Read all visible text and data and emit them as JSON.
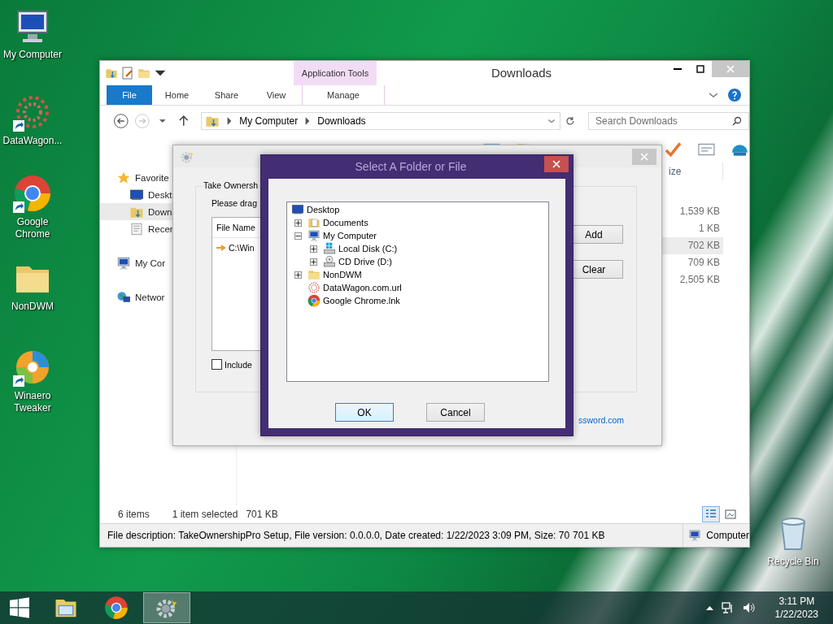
{
  "desktop_icons": [
    {
      "label": "My Computer",
      "kind": "computer",
      "shortcut": false
    },
    {
      "label": "DataWagon...",
      "kind": "flower",
      "shortcut": true
    },
    {
      "label": "Google Chrome",
      "kind": "chrome",
      "shortcut": true
    },
    {
      "label": "NonDWM",
      "kind": "folder",
      "shortcut": false
    },
    {
      "label": "Winaero Tweaker",
      "kind": "swirl",
      "shortcut": true
    },
    {
      "label": "Recycle Bin",
      "kind": "bin",
      "shortcut": false
    }
  ],
  "explorer": {
    "title": "Downloads",
    "contextual_group": "Application Tools",
    "ribbon_tabs": [
      {
        "label": "File",
        "kind": "file"
      },
      {
        "label": "Home",
        "kind": "tab"
      },
      {
        "label": "Share",
        "kind": "tab"
      },
      {
        "label": "View",
        "kind": "tab"
      },
      {
        "label": "Manage",
        "kind": "contextual"
      }
    ],
    "address": {
      "crumbs": [
        "My Computer",
        "Downloads"
      ]
    },
    "search": {
      "placeholder": "Search Downloads"
    },
    "nav": [
      {
        "label": "Favorite",
        "kind": "star",
        "selected": false,
        "children": [
          {
            "label": "Deskt",
            "kind": "desktop",
            "selected": false
          },
          {
            "label": "Down",
            "kind": "downloads",
            "selected": true
          },
          {
            "label": "Recer",
            "kind": "recent",
            "selected": false
          }
        ]
      },
      {
        "label": "My Cor",
        "kind": "computer",
        "selected": false
      },
      {
        "label": "Networ",
        "kind": "network",
        "selected": false
      }
    ],
    "column_header": "ize",
    "rows": [
      {
        "size": "1,539 KB",
        "selected": false
      },
      {
        "size": "1 KB",
        "selected": false
      },
      {
        "size": "702 KB",
        "selected": true
      },
      {
        "size": "709 KB",
        "selected": false
      },
      {
        "size": "2,505 KB",
        "selected": false
      }
    ],
    "status": {
      "count": "6 items",
      "selection": "1 item selected",
      "selection_size": "701 KB"
    },
    "view_buttons": [
      {
        "kind": "details",
        "selected": true
      },
      {
        "kind": "tiles",
        "selected": false
      }
    ],
    "details_bar": {
      "description": "File description: TakeOwnershipPro Setup, File version: 0.0.0.0, Date created: 1/22/2023 3:09 PM, Size: 70",
      "size": "701 KB",
      "location": "Computer"
    }
  },
  "take_ownership": {
    "group_label": "Take Ownersh",
    "instruction": "Please drag",
    "list": {
      "column": "File Name",
      "rows": [
        "C:\\Win"
      ]
    },
    "include": {
      "label": "Include",
      "checked": false
    },
    "buttons": [
      "Add",
      "Clear"
    ],
    "link": "ssword.com"
  },
  "select_dialog": {
    "title": "Select A Folder or File",
    "tree": [
      {
        "label": "Desktop",
        "kind": "desktop",
        "children": [
          {
            "label": "Documents",
            "kind": "docs",
            "expanded": false
          },
          {
            "label": "My Computer",
            "kind": "computer",
            "expanded": true,
            "children": [
              {
                "label": "Local Disk (C:)",
                "kind": "disk",
                "expanded": false
              },
              {
                "label": "CD Drive (D:)",
                "kind": "cd",
                "expanded": false
              }
            ]
          },
          {
            "label": "NonDWM",
            "kind": "folder",
            "expanded": false
          },
          {
            "label": "DataWagon.com.url",
            "kind": "flower"
          },
          {
            "label": "Google Chrome.lnk",
            "kind": "chrome"
          }
        ]
      }
    ],
    "buttons": [
      {
        "label": "OK",
        "default": true
      },
      {
        "label": "Cancel",
        "default": false
      }
    ]
  },
  "taskbar": {
    "apps": [
      {
        "kind": "explorer",
        "active": false
      },
      {
        "kind": "chrome",
        "active": false
      },
      {
        "kind": "gear",
        "active": true
      }
    ],
    "time": "3:11 PM",
    "date": "1/22/2023"
  }
}
